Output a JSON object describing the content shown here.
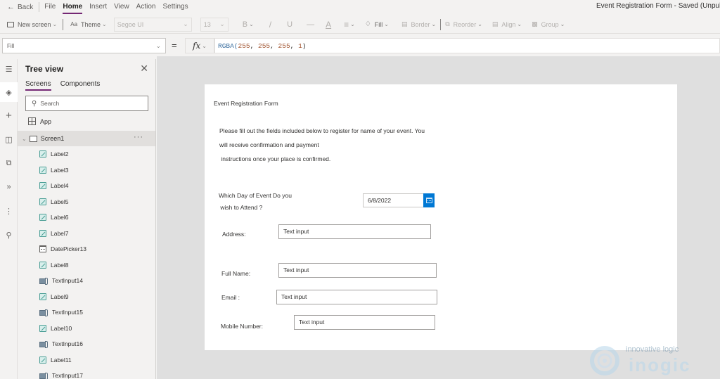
{
  "menubar": {
    "back_label": "Back",
    "items": [
      {
        "label": "File",
        "active": false
      },
      {
        "label": "Home",
        "active": true
      },
      {
        "label": "Insert",
        "active": false
      },
      {
        "label": "View",
        "active": false
      },
      {
        "label": "Action",
        "active": false
      },
      {
        "label": "Settings",
        "active": false
      }
    ],
    "window_title": "Event Registration Form - Saved (Unpublished)"
  },
  "toolbar": {
    "new_screen": "New screen",
    "theme": "Theme",
    "font_family": "Segoe UI",
    "font_size": "13",
    "bold": "B",
    "italic": "/",
    "underline": "U",
    "strikethrough": "—",
    "font_color": "A",
    "align_text": "≡",
    "fill": "Fill",
    "border": "Border",
    "reorder": "Reorder",
    "align": "Align",
    "group": "Group"
  },
  "formulabar": {
    "property": "Fill",
    "equals": "=",
    "fx": "fx",
    "formula": {
      "fn": "RGBA(",
      "args": [
        "255",
        "255",
        "255",
        "1"
      ],
      "close": ")"
    }
  },
  "rail": {
    "icons": [
      "hamburger-icon",
      "layers-icon",
      "plus-icon",
      "database-icon",
      "media-icon",
      "power-automate-icon",
      "variables-icon",
      "search-icon"
    ]
  },
  "tree": {
    "title": "Tree view",
    "close": "✕",
    "tabs": [
      {
        "label": "Screens",
        "active": true
      },
      {
        "label": "Components",
        "active": false
      }
    ],
    "search_placeholder": "Search",
    "app_label": "App",
    "screen_label": "Screen1",
    "screen_more": "···",
    "items": [
      {
        "label": "Label2",
        "type": "label"
      },
      {
        "label": "Label3",
        "type": "label"
      },
      {
        "label": "Label4",
        "type": "label"
      },
      {
        "label": "Label5",
        "type": "label"
      },
      {
        "label": "Label6",
        "type": "label"
      },
      {
        "label": "Label7",
        "type": "label"
      },
      {
        "label": "DatePicker13",
        "type": "date"
      },
      {
        "label": "Label8",
        "type": "label"
      },
      {
        "label": "TextInput14",
        "type": "text"
      },
      {
        "label": "Label9",
        "type": "label"
      },
      {
        "label": "TextInput15",
        "type": "text"
      },
      {
        "label": "Label10",
        "type": "label"
      },
      {
        "label": "TextInput16",
        "type": "text"
      },
      {
        "label": "Label11",
        "type": "label"
      },
      {
        "label": "TextInput17",
        "type": "text"
      }
    ]
  },
  "form": {
    "title": "Event Registration Form",
    "intro_line1": "Please fill out the fields included below to register for name of your event. You",
    "intro_line2": "will receive confirmation and payment",
    "intro_line3": " instructions once your place is confirmed.",
    "day_label_line1": "Which Day of Event Do you",
    "day_label_line2": " wish to Attend ?",
    "date_value": "6/8/2022",
    "address_label": "Address:",
    "address_value": "Text input",
    "fullname_label": "Full Name:",
    "fullname_value": "Text input",
    "email_label": "Email :",
    "email_value": "Text input",
    "mobile_label": "Mobile Number:",
    "mobile_value": "Text input"
  },
  "watermark": {
    "tagline": "innovative logic",
    "brand": "inogic"
  },
  "colors": {
    "accent": "#742774",
    "date_button": "#0078d4",
    "canvas_bg": "#dfdfdf",
    "chrome_bg": "#f3f2f1"
  }
}
